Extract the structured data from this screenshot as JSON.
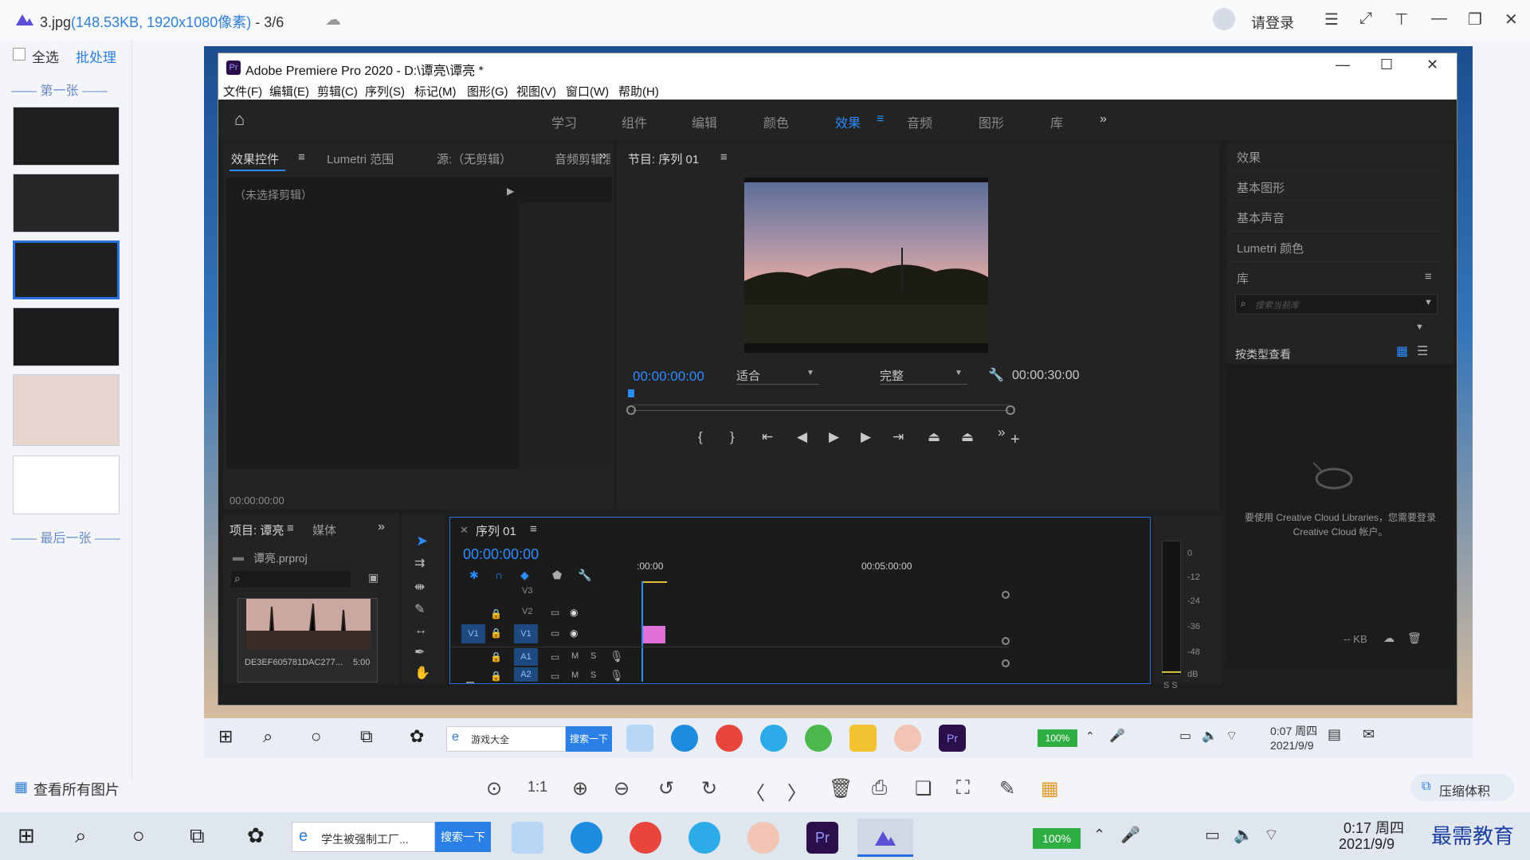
{
  "viewer": {
    "file_name": "3.jpg",
    "file_info_open": "(",
    "file_size": "148.53KB",
    "file_sep": ", ",
    "file_dims": "1920x1080像素",
    "file_info_close": ")",
    "page_indicator": " - 3/6",
    "login_label": "请登录",
    "select_all": "全选",
    "batch": "批处理",
    "first_label": "—— 第一张 ——",
    "last_label": "—— 最后一张 ——",
    "view_all": "查看所有图片",
    "compress": "压缩体积"
  },
  "premiere": {
    "title": "Adobe Premiere Pro 2020 - D:\\谭亮\\谭亮 *",
    "menu": [
      "文件(F)",
      "编辑(E)",
      "剪辑(C)",
      "序列(S)",
      "标记(M)",
      "图形(G)",
      "视图(V)",
      "窗口(W)",
      "帮助(H)"
    ],
    "workspaces": [
      "学习",
      "组件",
      "编辑",
      "颜色",
      "效果",
      "音频",
      "图形",
      "库"
    ],
    "active_workspace": "效果",
    "source_tabs": [
      "效果控件",
      "Lumetri 范围",
      "源:（无剪辑）",
      "音频剪辑混合器: 序列"
    ],
    "no_clip": "（未选择剪辑）",
    "source_timecode": "00:00:00:00",
    "program_title": "节目: 序列 01",
    "program_timecode": "00:00:00:00",
    "fit_label": "适合",
    "full_label": "完整",
    "program_duration": "00:00:30:00",
    "project_tabs": [
      "项目: 谭亮",
      "媒体"
    ],
    "project_file": "谭亮.prproj",
    "clip_name": "DE3EF605781DAC277...",
    "clip_duration": "5:00",
    "sequence_tab": "序列 01",
    "seq_timecode": "00:00:00:00",
    "ruler_labels": [
      ":00:00",
      "00:05:00:00"
    ],
    "tracks": [
      "V3",
      "V2",
      "V1",
      "A1",
      "A2"
    ],
    "meter_labels": [
      "0",
      "-12",
      "-24",
      "-36",
      "-48",
      "dB"
    ],
    "meter_solo": "S S",
    "right_panel": [
      "效果",
      "基本图形",
      "基本声音",
      "Lumetri 颜色"
    ],
    "library_title": "库",
    "library_search_placeholder": "搜索当前库",
    "view_by_type": "按类型查看",
    "cc_message": "要使用 Creative Cloud Libraries，您需要登录 Creative Cloud 帐户。",
    "kb_label": "-- KB"
  },
  "inner_taskbar": {
    "search_label": "游戏大全",
    "search_btn": "搜索一下",
    "battery": "100%",
    "time": "0:07 周四",
    "date": "2021/9/9"
  },
  "outer_taskbar": {
    "search_label": "学生被强制工厂...",
    "search_btn": "搜索一下",
    "battery": "100%",
    "time": "0:17 周四",
    "date": "2021/9/9",
    "watermark": "最需教育"
  },
  "colors": {
    "accent": "#2b8cff",
    "pr_purple": "#9999ff",
    "clip_pink": "#e070d6"
  }
}
